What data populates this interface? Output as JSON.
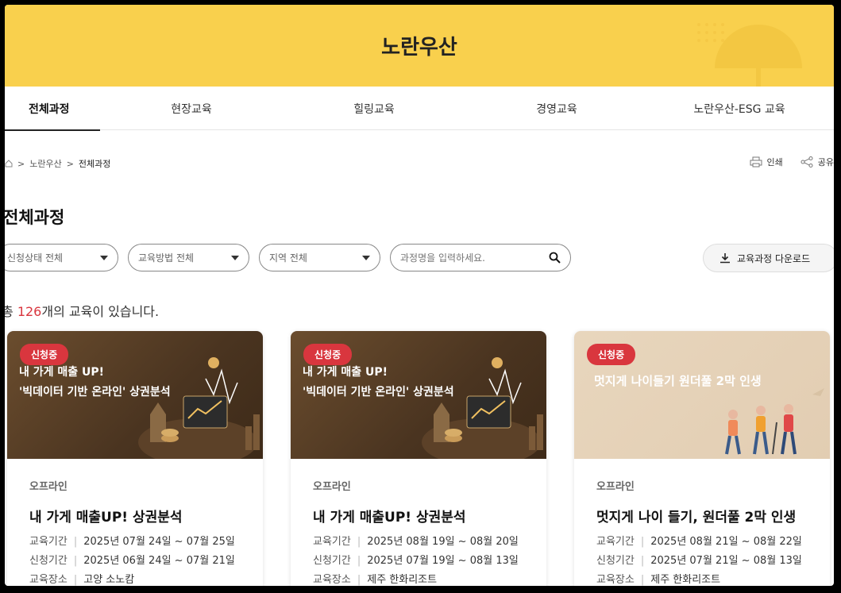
{
  "hero": {
    "title": "노란우산"
  },
  "tabs": [
    {
      "label": "전체과정",
      "active": true
    },
    {
      "label": "현장교육"
    },
    {
      "label": "힐링교육"
    },
    {
      "label": "경영교육"
    },
    {
      "label": "노란우산-ESG 교육"
    }
  ],
  "breadcrumb": {
    "home_icon": "home-icon",
    "items": [
      "노란우산",
      "전체과정"
    ]
  },
  "util": {
    "print": "인쇄",
    "share": "공유"
  },
  "page_title": "전체과정",
  "filters": {
    "status": "신청상태 전체",
    "method": "교육방법 전체",
    "region": "지역 전체",
    "search_placeholder": "과정명을 입력하세요.",
    "download": "교육과정 다운로드"
  },
  "count": {
    "prefix": "총 ",
    "number": "126",
    "suffix": "개의 교육이 있습니다."
  },
  "cards": [
    {
      "badge": "신청중",
      "thumb_line1": "내 가게 매출 UP!",
      "thumb_line2": "'빅데이터 기반 온라인' 상권분석",
      "type": "오프라인",
      "title": "내 가게 매출UP! 상권분석",
      "period_k": "교육기간",
      "period_v": "2025년 07월 24일 ~ 07월 25일",
      "apply_k": "신청기간",
      "apply_v": "2025년 06월 24일 ~ 07월 21일",
      "place_k": "교육장소",
      "place_v": "고양 소노캄"
    },
    {
      "badge": "신청중",
      "thumb_line1": "내 가게 매출 UP!",
      "thumb_line2": "'빅데이터 기반 온라인' 상권분석",
      "type": "오프라인",
      "title": "내 가게 매출UP! 상권분석",
      "period_k": "교육기간",
      "period_v": "2025년 08월 19일 ~ 08월 20일",
      "apply_k": "신청기간",
      "apply_v": "2025년 07월 19일 ~ 08월 13일",
      "place_k": "교육장소",
      "place_v": "제주 한화리조트"
    },
    {
      "badge": "신청중",
      "thumb_line1": "멋지게 나이들기 원더풀 2막 인생",
      "type": "오프라인",
      "title": "멋지게 나이 들기, 원더풀 2막 인생",
      "period_k": "교육기간",
      "period_v": "2025년 08월 21일 ~ 08월 22일",
      "apply_k": "신청기간",
      "apply_v": "2025년 07월 21일 ~ 08월 13일",
      "place_k": "교육장소",
      "place_v": "제주 한화리조트"
    }
  ],
  "colors": {
    "hero_bg": "#f9d04d",
    "accent_red": "#d9363e"
  }
}
